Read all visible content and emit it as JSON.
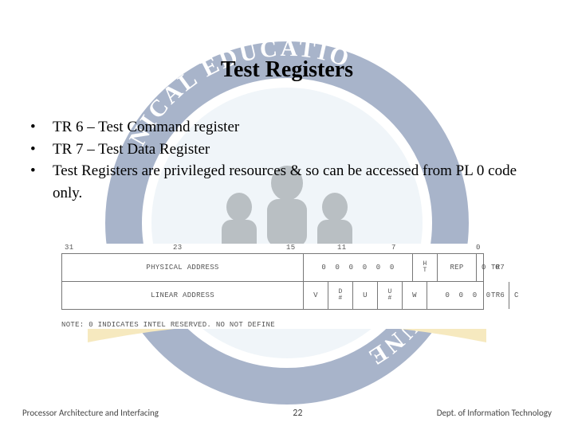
{
  "title": "Test Registers",
  "bullets": [
    "TR 6 – Test Command register",
    "TR 7 – Test Data Register",
    "Test Registers are privileged resources & so can be accessed from PL 0 code only."
  ],
  "diagram": {
    "ticks": {
      "t31": "31",
      "t23": "23",
      "t15": "15",
      "t11": "11",
      "t7": "7",
      "t0": "0"
    },
    "row1": {
      "label": "PHYSICAL ADDRESS",
      "zeros": "0  0  0  0  0  0",
      "ht": "H\nT",
      "rep": "REP",
      "right": "0  0",
      "name": "TR7"
    },
    "row2": {
      "label": "LINEAR ADDRESS",
      "v": "V",
      "d": "D\n#",
      "u": "U",
      "u2": "U\n#",
      "w": "W",
      "zeros": "0  0  0  0",
      "c": "C",
      "name": "TR6"
    },
    "note": "NOTE:  0  INDICATES  INTEL  RESERVED.  NO  NOT  DEFINE"
  },
  "footer": {
    "left": "Processor Architecture and Interfacing",
    "page": "22",
    "right": "Dept. of Information Technology"
  },
  "watermark_colors": {
    "ring": "#0a2a6b",
    "inner": "#d6e4ee",
    "ribbon": "#e6c24a",
    "dark": "#3a4a55"
  }
}
